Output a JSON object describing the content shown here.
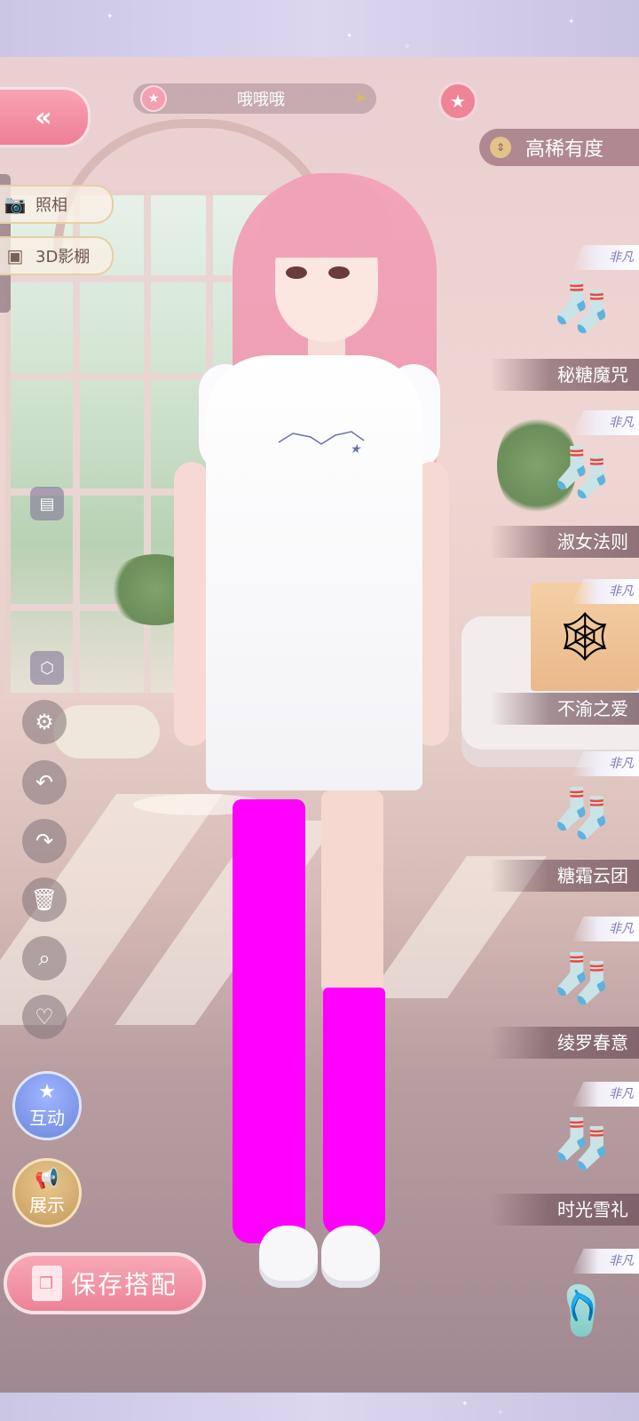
{
  "header": {
    "back_icon": "double-chevron-left-icon",
    "outfit_name": "哦哦哦",
    "name_star_icon": "star-icon",
    "next_icon": "arrow-right-icon",
    "favorite_icon": "star-icon"
  },
  "sort": {
    "label": "高稀有度",
    "icon": "sort-updown-icon"
  },
  "left_tools": {
    "photo_label": "照相",
    "studio_label": "3D影棚",
    "interact_label": "互动",
    "showcase_label": "展示",
    "save_label": "保存搭配"
  },
  "items": [
    {
      "name": "秘糖魔咒",
      "rarity": "非凡",
      "icon": "socks-icon",
      "selected": false
    },
    {
      "name": "淑女法则",
      "rarity": "非凡",
      "icon": "socks-icon",
      "selected": false
    },
    {
      "name": "不渝之爱",
      "rarity": "非凡",
      "icon": "fishnet-stockings-icon",
      "selected": true
    },
    {
      "name": "糖霜云团",
      "rarity": "非凡",
      "icon": "socks-icon",
      "selected": false
    },
    {
      "name": "绫罗春意",
      "rarity": "非凡",
      "icon": "socks-icon",
      "selected": false
    },
    {
      "name": "时光雪礼",
      "rarity": "非凡",
      "icon": "socks-icon",
      "selected": false
    },
    {
      "name": "",
      "rarity": "非凡",
      "icon": "strap-socks-icon",
      "selected": false
    }
  ],
  "colors": {
    "accent_pink": "#ef8497",
    "stocking_magenta": "#ff00ff",
    "badge_text": "#7b79b8"
  }
}
